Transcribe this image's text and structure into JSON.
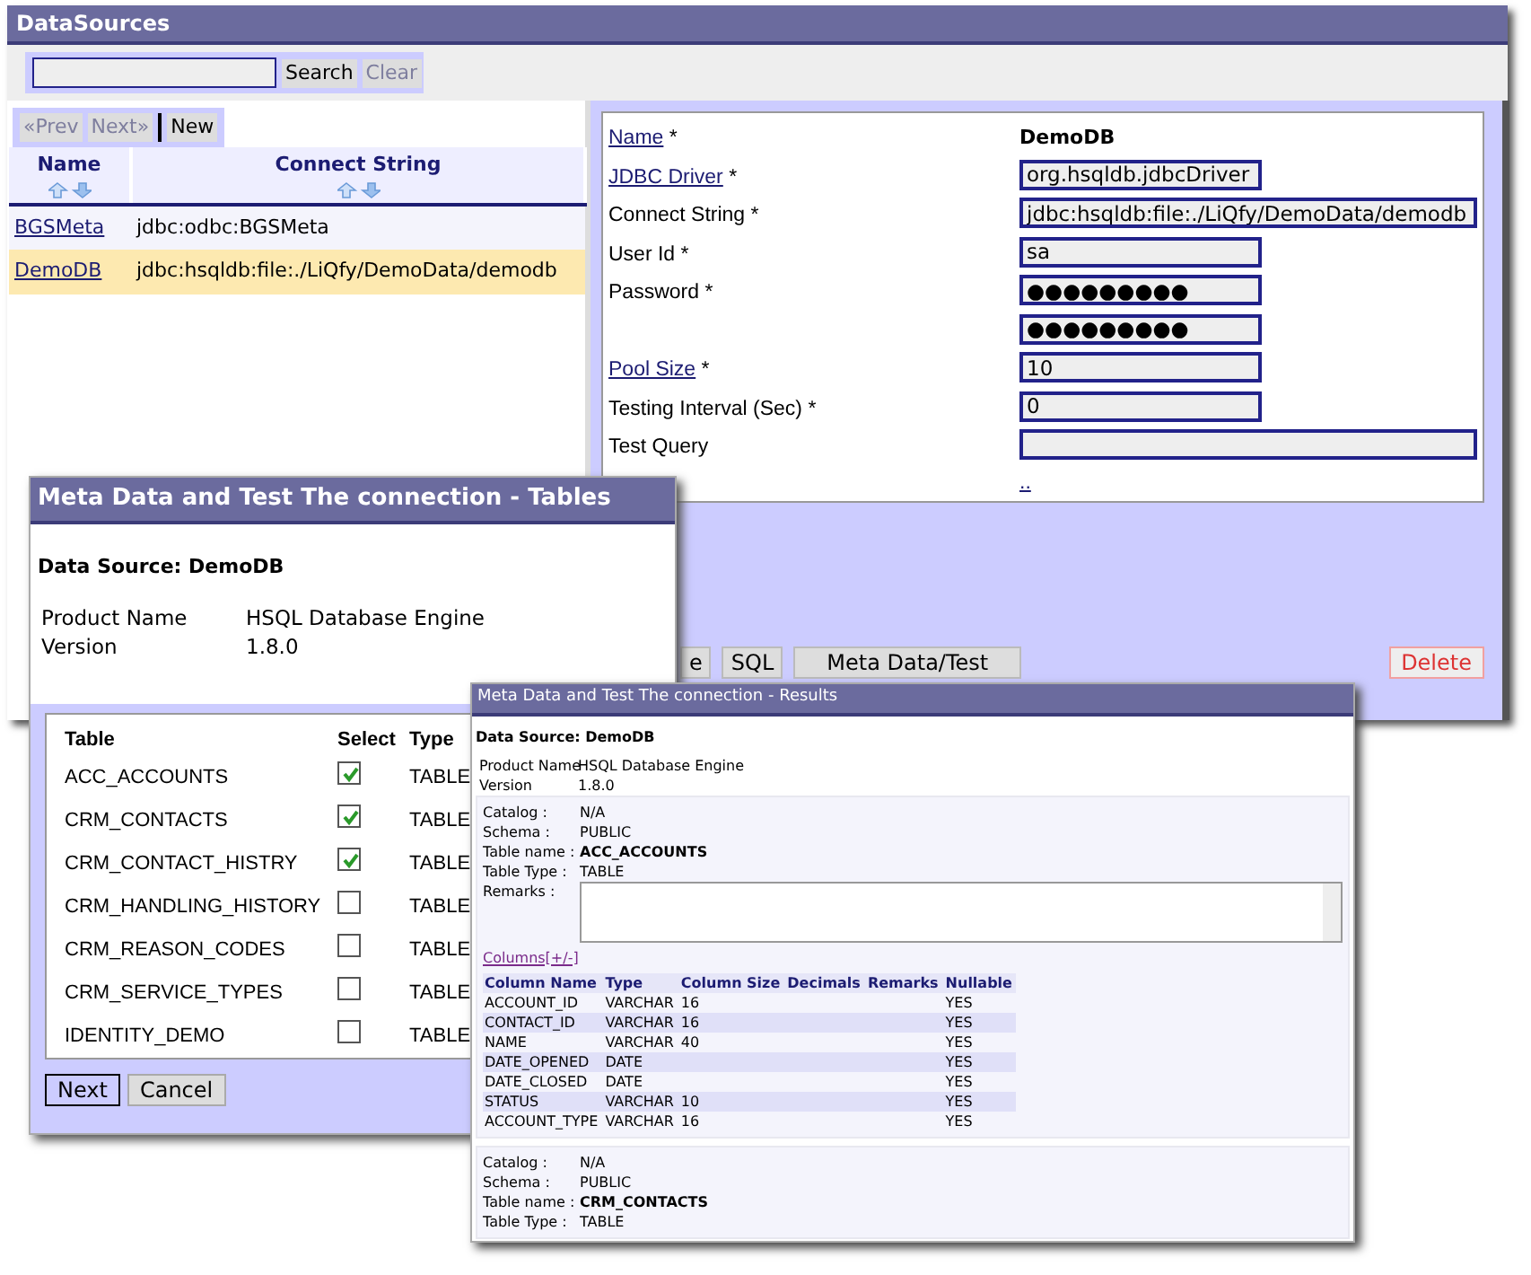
{
  "main_window": {
    "title": "DataSources",
    "search": {
      "button": "Search",
      "clear": {
        "label": "Clear",
        "disabled": true
      }
    },
    "pager": [
      {
        "label": "«Prev",
        "disabled": true
      },
      {
        "label": "Next»",
        "disabled": true
      },
      {
        "label": "New",
        "disabled": false
      }
    ],
    "list": {
      "columns": [
        "Name",
        "Connect String"
      ],
      "rows": [
        {
          "name": "BGSMeta",
          "connect": "jdbc:odbc:BGSMeta",
          "selected": false
        },
        {
          "name": "DemoDB",
          "connect": "jdbc:hsqldb:file:./LiQfy/DemoData/demodb",
          "selected": true
        }
      ]
    },
    "form": {
      "fields": [
        {
          "label": "Name",
          "mark": "*",
          "link": true,
          "kind": "static",
          "value": "DemoDB"
        },
        {
          "label": "JDBC Driver",
          "mark": "*",
          "link": true,
          "kind": "input",
          "value": "org.hsqldb.jdbcDriver"
        },
        {
          "label": "Connect String",
          "mark": "*",
          "link": false,
          "kind": "wide_input",
          "value": "jdbc:hsqldb:file:./LiQfy/DemoData/demodb"
        },
        {
          "label": "User Id",
          "mark": "*",
          "link": false,
          "kind": "input",
          "value": "sa"
        },
        {
          "label": "Password",
          "mark": "*",
          "link": false,
          "kind": "input",
          "value": "●●●●●●●●●"
        },
        {
          "kind": "input",
          "value": "●●●●●●●●●"
        },
        {
          "label": "Pool Size",
          "mark": "*",
          "link": true,
          "kind": "input",
          "value": "10"
        },
        {
          "label": "Testing Interval (Sec)",
          "mark": "*",
          "link": false,
          "kind": "input",
          "value": "0"
        },
        {
          "label": "Test Query",
          "link": false,
          "kind": "wide_input"
        },
        {
          "kind": "link",
          "value": ".."
        }
      ]
    },
    "buttons": [
      {
        "label": "e",
        "kind": "normal"
      },
      {
        "label": "SQL",
        "kind": "normal"
      },
      {
        "label": "Meta Data/Test",
        "kind": "wide"
      },
      {
        "label": "Delete",
        "kind": "danger"
      }
    ]
  },
  "tables_window": {
    "title": "Meta Data and Test The connection - Tables",
    "data_source": "Data Source: DemoDB",
    "info": [
      {
        "label": "Product Name",
        "value": "HSQL Database Engine"
      },
      {
        "label": "Version",
        "value": "1.8.0"
      }
    ],
    "columns": [
      "Table",
      "Select",
      "Type"
    ],
    "rows": [
      {
        "table": "ACC_ACCOUNTS",
        "checked": true,
        "type": "TABLE"
      },
      {
        "table": "CRM_CONTACTS",
        "checked": true,
        "type": "TABLE"
      },
      {
        "table": "CRM_CONTACT_HISTRY",
        "checked": true,
        "type": "TABLE"
      },
      {
        "table": "CRM_HANDLING_HISTORY",
        "checked": false,
        "type": "TABLE"
      },
      {
        "table": "CRM_REASON_CODES",
        "checked": false,
        "type": "TABLE"
      },
      {
        "table": "CRM_SERVICE_TYPES",
        "checked": false,
        "type": "TABLE"
      },
      {
        "table": "IDENTITY_DEMO",
        "checked": false,
        "type": "TABLE"
      }
    ],
    "buttons": [
      {
        "label": "Next",
        "focused": true
      },
      {
        "label": "Cancel",
        "focused": false
      }
    ]
  },
  "results_window": {
    "title": "Meta Data and Test The connection - Results",
    "data_source": "Data Source: DemoDB",
    "info": [
      {
        "label": "Product Name",
        "value": "HSQL Database Engine"
      },
      {
        "label": "Version",
        "value": "1.8.0"
      }
    ],
    "sections": [
      {
        "props": [
          {
            "label": "Catalog :",
            "value": "N/A",
            "bold": false
          },
          {
            "label": "Schema :",
            "value": "PUBLIC",
            "bold": false
          },
          {
            "label": "Table name :",
            "value": "ACC_ACCOUNTS",
            "bold": true
          },
          {
            "label": "Table Type :",
            "value": "TABLE",
            "bold": false
          }
        ],
        "remarks_label": "Remarks :",
        "columns_link": "Columns[+/-]",
        "columns": [
          "Column Name",
          "Type",
          "Column Size",
          "Decimals",
          "Remarks",
          "Nullable"
        ],
        "rows": [
          {
            "name": "ACCOUNT_ID",
            "type": "VARCHAR",
            "size": "16",
            "nullable": "YES"
          },
          {
            "name": "CONTACT_ID",
            "type": "VARCHAR",
            "size": "16",
            "nullable": "YES"
          },
          {
            "name": "NAME",
            "type": "VARCHAR",
            "size": "40",
            "nullable": "YES"
          },
          {
            "name": "DATE_OPENED",
            "type": "DATE",
            "nullable": "YES"
          },
          {
            "name": "DATE_CLOSED",
            "type": "DATE",
            "nullable": "YES"
          },
          {
            "name": "STATUS",
            "type": "VARCHAR",
            "size": "10",
            "nullable": "YES"
          },
          {
            "name": "ACCOUNT_TYPE",
            "type": "VARCHAR",
            "size": "16",
            "nullable": "YES"
          }
        ]
      },
      {
        "props": [
          {
            "label": "Catalog :",
            "value": "N/A",
            "bold": false
          },
          {
            "label": "Schema :",
            "value": "PUBLIC",
            "bold": false
          },
          {
            "label": "Table name :",
            "value": "CRM_CONTACTS",
            "bold": true
          },
          {
            "label": "Table Type :",
            "value": "TABLE",
            "bold": false
          }
        ]
      }
    ]
  }
}
